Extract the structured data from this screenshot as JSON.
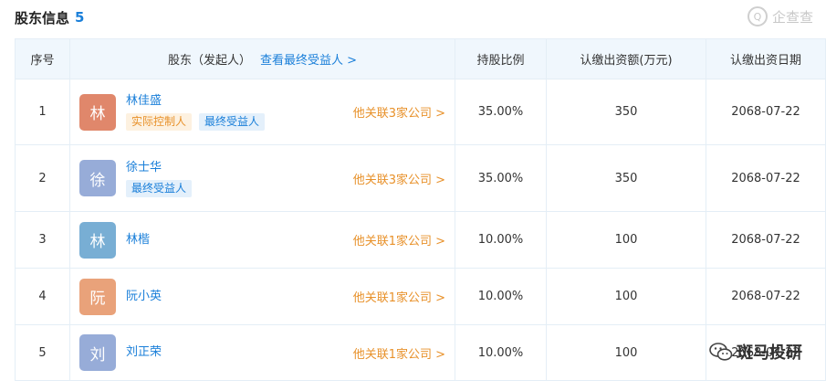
{
  "header": {
    "title": "股东信息",
    "count": "5"
  },
  "brand": {
    "name": "企查查",
    "icon": "qichacha-logo-icon"
  },
  "table": {
    "columns": {
      "index": "序号",
      "holder": "股东（发起人）",
      "holder_link": "查看最终受益人 >",
      "ratio": "持股比例",
      "capital": "认缴出资额(万元)",
      "date": "认缴出资日期"
    },
    "rows": [
      {
        "index": "1",
        "avatar": "林",
        "avatar_color": "#e0876b",
        "name": "林佳盛",
        "tag1": "实际控制人",
        "tag2": "最终受益人",
        "related": "他关联3家公司 >",
        "ratio": "35.00%",
        "capital": "350",
        "date": "2068-07-22"
      },
      {
        "index": "2",
        "avatar": "徐",
        "avatar_color": "#97acd8",
        "name": "徐士华",
        "tag1": "最终受益人",
        "related": "他关联3家公司 >",
        "ratio": "35.00%",
        "capital": "350",
        "date": "2068-07-22"
      },
      {
        "index": "3",
        "avatar": "林",
        "avatar_color": "#78aed4",
        "name": "林楷",
        "related": "他关联1家公司 >",
        "ratio": "10.00%",
        "capital": "100",
        "date": "2068-07-22"
      },
      {
        "index": "4",
        "avatar": "阮",
        "avatar_color": "#e9a27a",
        "name": "阮小英",
        "related": "他关联1家公司 >",
        "ratio": "10.00%",
        "capital": "100",
        "date": "2068-07-22"
      },
      {
        "index": "5",
        "avatar": "刘",
        "avatar_color": "#97acd8",
        "name": "刘正荣",
        "related": "他关联1家公司 >",
        "ratio": "10.00%",
        "capital": "100",
        "date": "2068-07-22"
      }
    ]
  },
  "watermark": {
    "text": "斑马投研",
    "icon": "wechat-icon"
  }
}
